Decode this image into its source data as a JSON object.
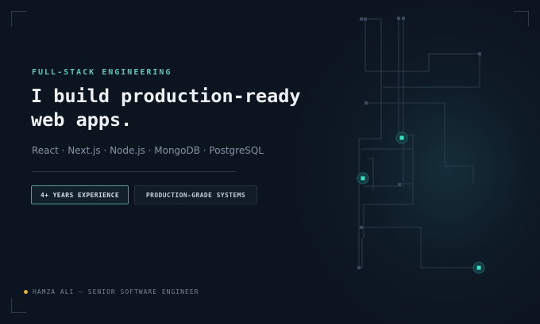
{
  "hero": {
    "eyebrow": "FULL-STACK ENGINEERING",
    "headline_line1": "I build production-ready",
    "headline_line2": "web apps.",
    "tech_stack": "React · Next.js · Node.js · MongoDB · PostgreSQL"
  },
  "badges": {
    "experience": "4+ YEARS EXPERIENCE",
    "systems": "PRODUCTION-GRADE SYSTEMS"
  },
  "footer": {
    "signature": "HAMZA ALI — SENIOR SOFTWARE ENGINEER"
  },
  "colors": {
    "background": "#0c1420",
    "accent_teal": "#5ec8b4",
    "node_glow": "#3fe0c8",
    "status_dot": "#e0b43c"
  },
  "icons": [
    "circuit-graphic",
    "status-dot-icon",
    "corner-bracket-icon"
  ]
}
